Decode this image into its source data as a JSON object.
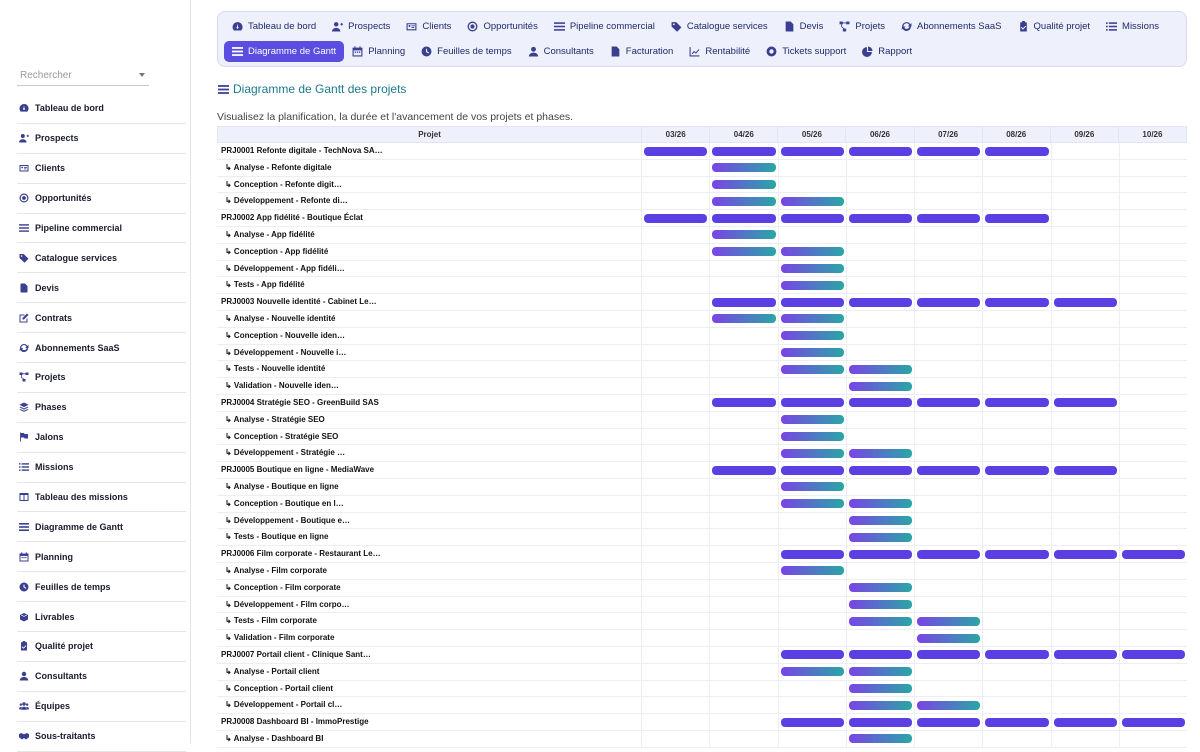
{
  "search": {
    "placeholder": "Rechercher"
  },
  "sidebar": {
    "items": [
      {
        "label": "Tableau de bord",
        "icon": "dashboard-icon"
      },
      {
        "label": "Prospects",
        "icon": "user-plus-icon"
      },
      {
        "label": "Clients",
        "icon": "id-card-icon"
      },
      {
        "label": "Opportunités",
        "icon": "target-icon"
      },
      {
        "label": "Pipeline commercial",
        "icon": "bars-icon"
      },
      {
        "label": "Catalogue services",
        "icon": "tag-icon"
      },
      {
        "label": "Devis",
        "icon": "document-icon"
      },
      {
        "label": "Contrats",
        "icon": "edit-icon"
      },
      {
        "label": "Abonnements SaaS",
        "icon": "sync-icon"
      },
      {
        "label": "Projets",
        "icon": "project-diagram-icon"
      },
      {
        "label": "Phases",
        "icon": "layers-icon"
      },
      {
        "label": "Jalons",
        "icon": "flag-icon"
      },
      {
        "label": "Missions",
        "icon": "list-icon"
      },
      {
        "label": "Tableau des missions",
        "icon": "columns-icon"
      },
      {
        "label": "Diagramme de Gantt",
        "icon": "gantt-icon"
      },
      {
        "label": "Planning",
        "icon": "calendar-icon"
      },
      {
        "label": "Feuilles de temps",
        "icon": "clock-icon"
      },
      {
        "label": "Livrables",
        "icon": "box-icon"
      },
      {
        "label": "Qualité projet",
        "icon": "clipboard-check-icon"
      },
      {
        "label": "Consultants",
        "icon": "user-icon"
      },
      {
        "label": "Équipes",
        "icon": "users-icon"
      },
      {
        "label": "Sous-traitants",
        "icon": "handshake-icon"
      }
    ]
  },
  "topnav": {
    "row1": [
      {
        "label": "Tableau de bord",
        "icon": "dashboard-icon"
      },
      {
        "label": "Prospects",
        "icon": "user-plus-icon"
      },
      {
        "label": "Clients",
        "icon": "id-card-icon"
      },
      {
        "label": "Opportunités",
        "icon": "target-icon"
      },
      {
        "label": "Pipeline commercial",
        "icon": "bars-icon"
      },
      {
        "label": "Catalogue services",
        "icon": "tag-icon"
      },
      {
        "label": "Devis",
        "icon": "document-icon"
      },
      {
        "label": "Projets",
        "icon": "project-diagram-icon"
      },
      {
        "label": "Abonnements SaaS",
        "icon": "sync-icon"
      },
      {
        "label": "Qualité projet",
        "icon": "clipboard-check-icon"
      },
      {
        "label": "Missions",
        "icon": "list-icon"
      }
    ],
    "row2": [
      {
        "label": "Diagramme de Gantt",
        "icon": "gantt-icon",
        "active": true
      },
      {
        "label": "Planning",
        "icon": "calendar-icon"
      },
      {
        "label": "Feuilles de temps",
        "icon": "clock-icon"
      },
      {
        "label": "Consultants",
        "icon": "user-icon"
      },
      {
        "label": "Facturation",
        "icon": "document-icon"
      },
      {
        "label": "Rentabilité",
        "icon": "chart-line-icon"
      },
      {
        "label": "Tickets support",
        "icon": "support-icon"
      },
      {
        "label": "Rapport",
        "icon": "pie-chart-icon"
      }
    ]
  },
  "page": {
    "title": "Diagramme de Gantt des projets",
    "subtitle": "Visualisez la planification, la durée et l'avancement de vos projets et phases."
  },
  "gantt": {
    "label_header": "Projet",
    "months": [
      "03/26",
      "04/26",
      "05/26",
      "06/26",
      "07/26",
      "08/26",
      "09/26",
      "10/26"
    ],
    "colors": {
      "project": "#5b3fe2",
      "phase_start": "#7a44e6",
      "phase_end": "#2aa6a6"
    },
    "rows": [
      {
        "label": "PRJ0001 Refonte digitale - TechNova SA…",
        "type": "project",
        "start": 0,
        "end": 5
      },
      {
        "label": "↳ Analyse - Refonte digitale",
        "type": "phase",
        "start": 1,
        "end": 1
      },
      {
        "label": "↳ Conception - Refonte digit…",
        "type": "phase",
        "start": 1,
        "end": 1
      },
      {
        "label": "↳ Développement - Refonte di…",
        "type": "phase",
        "start": 1,
        "end": 2
      },
      {
        "label": "PRJ0002 App fidélité - Boutique Éclat",
        "type": "project",
        "start": 0,
        "end": 5
      },
      {
        "label": "↳ Analyse - App fidélité",
        "type": "phase",
        "start": 1,
        "end": 1
      },
      {
        "label": "↳ Conception - App fidélité",
        "type": "phase",
        "start": 1,
        "end": 2
      },
      {
        "label": "↳ Développement - App fidéli…",
        "type": "phase",
        "start": 2,
        "end": 2
      },
      {
        "label": "↳ Tests - App fidélité",
        "type": "phase",
        "start": 2,
        "end": 2
      },
      {
        "label": "PRJ0003 Nouvelle identité - Cabinet Le…",
        "type": "project",
        "start": 1,
        "end": 6
      },
      {
        "label": "↳ Analyse - Nouvelle identité",
        "type": "phase",
        "start": 1,
        "end": 2
      },
      {
        "label": "↳ Conception - Nouvelle iden…",
        "type": "phase",
        "start": 2,
        "end": 2
      },
      {
        "label": "↳ Développement - Nouvelle i…",
        "type": "phase",
        "start": 2,
        "end": 2
      },
      {
        "label": "↳ Tests - Nouvelle identité",
        "type": "phase",
        "start": 2,
        "end": 3
      },
      {
        "label": "↳ Validation - Nouvelle iden…",
        "type": "phase",
        "start": 3,
        "end": 3
      },
      {
        "label": "PRJ0004 Stratégie SEO - GreenBuild SAS",
        "type": "project",
        "start": 1,
        "end": 6
      },
      {
        "label": "↳ Analyse - Stratégie SEO",
        "type": "phase",
        "start": 2,
        "end": 2
      },
      {
        "label": "↳ Conception - Stratégie SEO",
        "type": "phase",
        "start": 2,
        "end": 2
      },
      {
        "label": "↳ Développement - Stratégie …",
        "type": "phase",
        "start": 2,
        "end": 3
      },
      {
        "label": "PRJ0005 Boutique en ligne - MediaWave",
        "type": "project",
        "start": 1,
        "end": 6
      },
      {
        "label": "↳ Analyse - Boutique en ligne",
        "type": "phase",
        "start": 2,
        "end": 2
      },
      {
        "label": "↳ Conception - Boutique en l…",
        "type": "phase",
        "start": 2,
        "end": 3
      },
      {
        "label": "↳ Développement - Boutique e…",
        "type": "phase",
        "start": 3,
        "end": 3
      },
      {
        "label": "↳ Tests - Boutique en ligne",
        "type": "phase",
        "start": 3,
        "end": 3
      },
      {
        "label": "PRJ0006 Film corporate - Restaurant Le…",
        "type": "project",
        "start": 2,
        "end": 7
      },
      {
        "label": "↳ Analyse - Film corporate",
        "type": "phase",
        "start": 2,
        "end": 2
      },
      {
        "label": "↳ Conception - Film corporate",
        "type": "phase",
        "start": 3,
        "end": 3
      },
      {
        "label": "↳ Développement - Film corpo…",
        "type": "phase",
        "start": 3,
        "end": 3
      },
      {
        "label": "↳ Tests - Film corporate",
        "type": "phase",
        "start": 3,
        "end": 4
      },
      {
        "label": "↳ Validation - Film corporate",
        "type": "phase",
        "start": 4,
        "end": 4
      },
      {
        "label": "PRJ0007 Portail client - Clinique Sant…",
        "type": "project",
        "start": 2,
        "end": 7
      },
      {
        "label": "↳ Analyse - Portail client",
        "type": "phase",
        "start": 2,
        "end": 3
      },
      {
        "label": "↳ Conception - Portail client",
        "type": "phase",
        "start": 3,
        "end": 3
      },
      {
        "label": "↳ Développement - Portail cl…",
        "type": "phase",
        "start": 3,
        "end": 4
      },
      {
        "label": "PRJ0008 Dashboard BI - ImmoPrestige",
        "type": "project",
        "start": 2,
        "end": 7
      },
      {
        "label": "↳ Analyse - Dashboard BI",
        "type": "phase",
        "start": 3,
        "end": 3
      }
    ]
  }
}
